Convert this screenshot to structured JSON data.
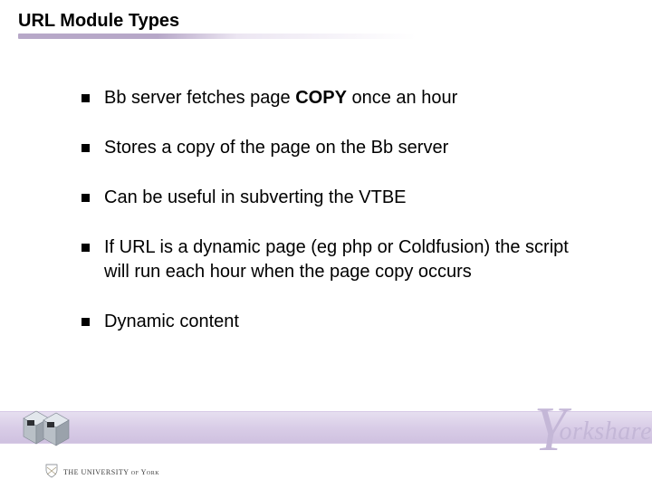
{
  "slide": {
    "title": "URL Module Types",
    "bullets": [
      {
        "pre": "Bb server fetches page ",
        "strong": "COPY",
        "post": " once an hour"
      },
      {
        "pre": "Stores a copy of the page on the Bb server",
        "strong": "",
        "post": ""
      },
      {
        "pre": "Can be useful in subverting the VTBE",
        "strong": "",
        "post": ""
      },
      {
        "pre": "If URL is a dynamic page (eg php or Coldfusion) the script will run each hour when the page copy occurs",
        "strong": "",
        "post": ""
      },
      {
        "pre": "Dynamic content",
        "strong": "",
        "post": ""
      }
    ]
  },
  "brand": {
    "yorkshare_initial": "Y",
    "yorkshare_rest": "orkshare",
    "university_label": "THE UNIVERSITY of York"
  }
}
